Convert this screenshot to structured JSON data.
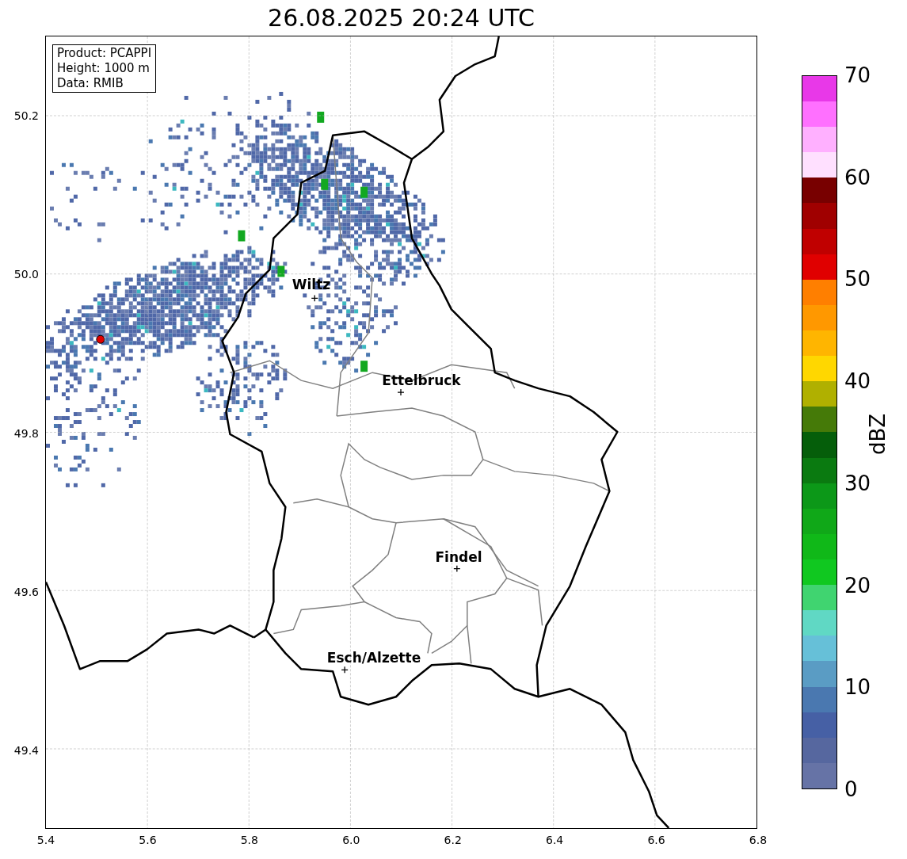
{
  "title": "26.08.2025 20:24 UTC",
  "info_box": [
    "Product: PCAPPI",
    "Height: 1000 m",
    "Data: RMIB"
  ],
  "map": {
    "cities": [
      {
        "name": "Wiltz"
      },
      {
        "name": "Ettelbruck"
      },
      {
        "name": "Findel"
      },
      {
        "name": "Esch/Alzette"
      }
    ],
    "x_ticks": [
      "5.4",
      "5.6",
      "5.8",
      "6.0",
      "6.2",
      "6.4",
      "6.6",
      "6.8"
    ],
    "y_ticks": [
      "50.2",
      "50.0",
      "49.8",
      "49.6",
      "49.4"
    ]
  },
  "colorbar": {
    "label": "dBZ",
    "ticks": [
      "70",
      "60",
      "50",
      "40",
      "30",
      "20",
      "10",
      "0"
    ],
    "bins": [
      {
        "color": "#6673a6"
      },
      {
        "color": "#56679f"
      },
      {
        "color": "#4660a5"
      },
      {
        "color": "#4a78b0"
      },
      {
        "color": "#5a9cc4"
      },
      {
        "color": "#66c0d8"
      },
      {
        "color": "#60d8c4"
      },
      {
        "color": "#40d470"
      },
      {
        "color": "#10c820"
      },
      {
        "color": "#10b818"
      },
      {
        "color": "#10a818"
      },
      {
        "color": "#0c9818"
      },
      {
        "color": "#0a7a10"
      },
      {
        "color": "#055e0a"
      },
      {
        "color": "#457a08"
      },
      {
        "color": "#b0b000"
      },
      {
        "color": "#ffd700"
      },
      {
        "color": "#ffb500"
      },
      {
        "color": "#ff9800"
      },
      {
        "color": "#ff7f00"
      },
      {
        "color": "#e00000"
      },
      {
        "color": "#c00000"
      },
      {
        "color": "#a00000"
      },
      {
        "color": "#780000"
      },
      {
        "color": "#ffe0ff"
      },
      {
        "color": "#ffb0ff"
      },
      {
        "color": "#ff70ff"
      },
      {
        "color": "#e838e8"
      }
    ]
  }
}
